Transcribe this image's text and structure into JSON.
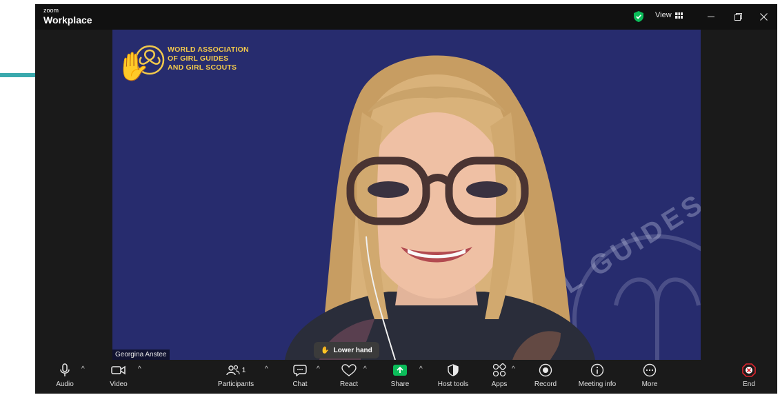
{
  "app": {
    "brand_small": "zoom",
    "brand_big": "Workplace"
  },
  "header": {
    "view_label": "View"
  },
  "video": {
    "logo_lines": [
      "WORLD ASSOCIATION",
      "OF GIRL GUIDES",
      "AND GIRL SCOUTS"
    ],
    "watermark_text": "L GUIDES AN",
    "participant_name": "Georgina Anstee",
    "raised_hand": "✋"
  },
  "lower_hand_label": "Lower hand",
  "toolbar": {
    "audio": "Audio",
    "video": "Video",
    "participants": "Participants",
    "participant_count": "1",
    "chat": "Chat",
    "react": "React",
    "share": "Share",
    "host_tools": "Host tools",
    "apps": "Apps",
    "record": "Record",
    "meeting_info": "Meeting info",
    "more": "More",
    "end": "End"
  },
  "colors": {
    "accent_green": "#0bbd5a",
    "end_red": "#e0242e",
    "brand_yellow": "#f2c94c",
    "annotation_teal": "#3aa9ad"
  }
}
